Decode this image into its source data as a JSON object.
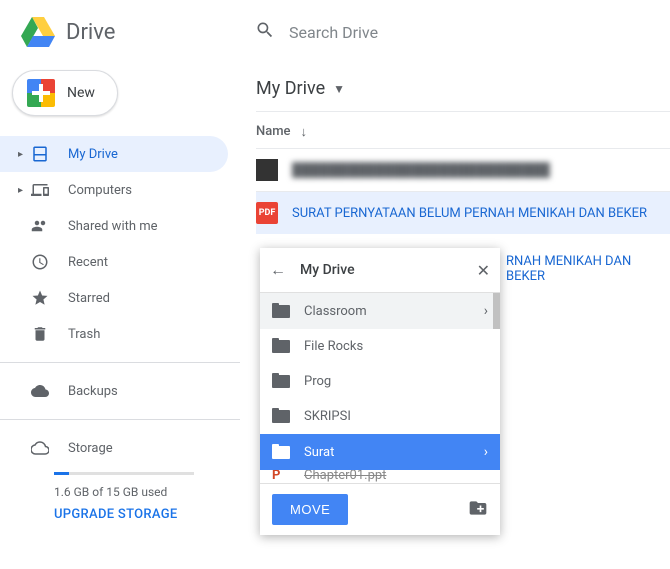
{
  "header": {
    "app_name": "Drive",
    "search_placeholder": "Search Drive"
  },
  "sidebar": {
    "new_label": "New",
    "items": [
      {
        "label": "My Drive",
        "icon": "drive-icon",
        "active": true,
        "expandable": true
      },
      {
        "label": "Computers",
        "icon": "computers-icon",
        "active": false,
        "expandable": true
      },
      {
        "label": "Shared with me",
        "icon": "shared-icon",
        "active": false,
        "expandable": false
      },
      {
        "label": "Recent",
        "icon": "recent-icon",
        "active": false,
        "expandable": false
      },
      {
        "label": "Starred",
        "icon": "starred-icon",
        "active": false,
        "expandable": false
      },
      {
        "label": "Trash",
        "icon": "trash-icon",
        "active": false,
        "expandable": false
      }
    ],
    "backups_label": "Backups",
    "storage_label": "Storage",
    "storage_used": "1.6 GB of 15 GB used",
    "upgrade_label": "UPGRADE STORAGE"
  },
  "content": {
    "breadcrumb": "My Drive",
    "column_name": "Name",
    "files": [
      {
        "name": "████████████████████████████",
        "type": "blurred",
        "selected": false
      },
      {
        "name": "SURAT PERNYATAAN BELUM PERNAH MENIKAH DAN BEKER",
        "type": "pdf",
        "selected": true
      },
      {
        "name": "RNAH MENIKAH DAN BEKER",
        "type": "hidden",
        "selected": false
      }
    ]
  },
  "move_dialog": {
    "title": "My Drive",
    "folders": [
      {
        "name": "Classroom",
        "has_sub": true,
        "highlight": true,
        "selected": false
      },
      {
        "name": "File Rocks",
        "has_sub": false,
        "highlight": false,
        "selected": false
      },
      {
        "name": "Prog",
        "has_sub": false,
        "highlight": false,
        "selected": false
      },
      {
        "name": "SKRIPSI",
        "has_sub": false,
        "highlight": false,
        "selected": false
      },
      {
        "name": "Surat",
        "has_sub": true,
        "highlight": false,
        "selected": true
      }
    ],
    "partial_file": "Chapter01.ppt",
    "move_button": "MOVE"
  }
}
